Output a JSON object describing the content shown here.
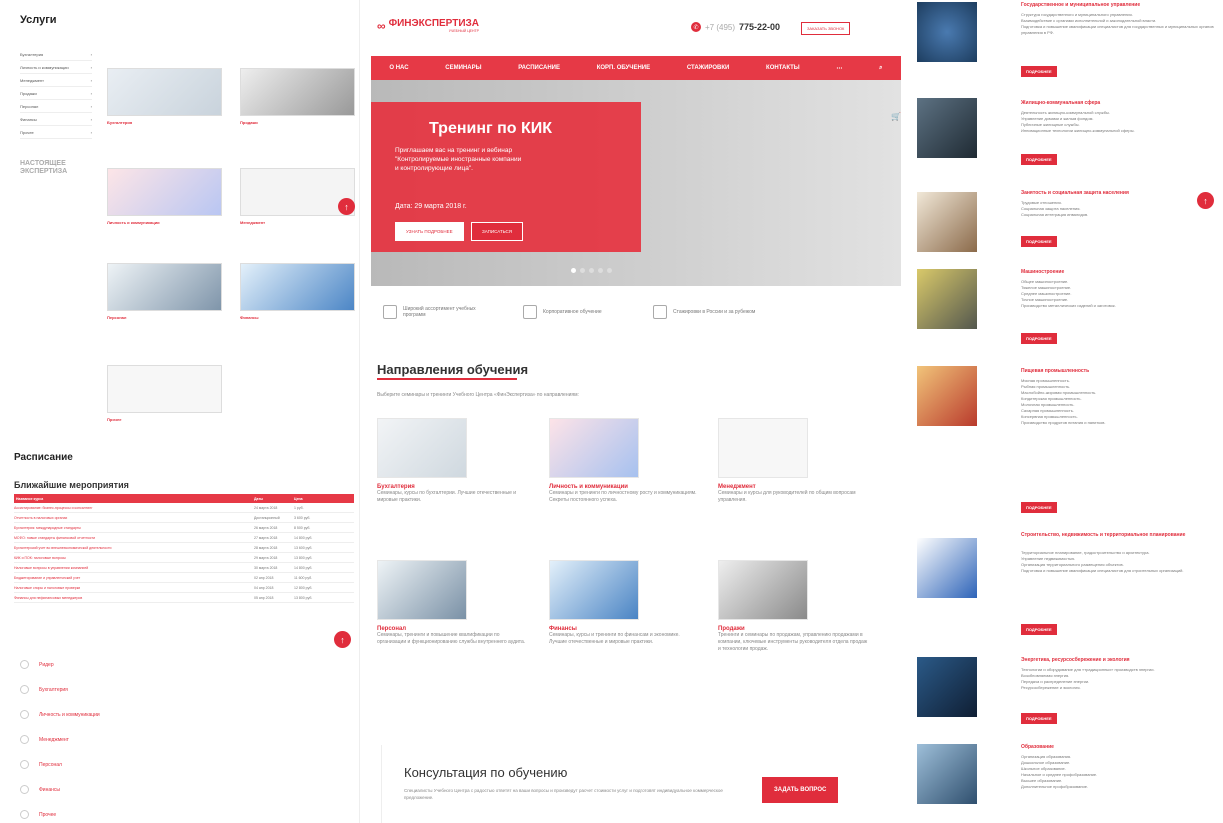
{
  "left": {
    "services_title": "Услуги",
    "menu": [
      "Бухгалтерия",
      "Личность и коммуникации",
      "Менеджмент",
      "Продажи",
      "Персонал",
      "Финансы",
      "Прочее"
    ],
    "logo_text": "НАСТОЯЩЕЕ ЭКСПЕРТИЗА",
    "cards": [
      {
        "title": "Бухгалтерия"
      },
      {
        "title": "Продажи"
      },
      {
        "title": "Личность и коммуникации"
      },
      {
        "title": "Менеджмент"
      },
      {
        "title": "Персонал"
      },
      {
        "title": "Финансы"
      },
      {
        "title": "Прочее"
      }
    ],
    "schedule_title": "Расписание",
    "nearest_events": "Ближайшие мероприятия",
    "table_headers": [
      "Название курса",
      "Даты",
      "Цена"
    ],
    "table_rows": [
      [
        "Ассистирование: бизнес-процессы и консалтинг",
        "24 марта 2018",
        "1 руб."
      ],
      [
        "Отчетность в налоговых органах",
        "Дистанционный",
        "3 600 руб."
      ],
      [
        "Бухгалтерия: международные стандарты",
        "26 марта 2018",
        "8 500 руб."
      ],
      [
        "МСФО: новые стандарты финансовой отчетности",
        "27 марта 2018",
        "14 800 руб."
      ],
      [
        "Бухгалтерский учет во внешнеэкономической деятельности",
        "28 марта 2018",
        "13 600 руб."
      ],
      [
        "КИК и ПОК: налоговые вопросы",
        "29 марта 2018",
        "13 800 руб."
      ],
      [
        "Налоговые вопросы в управлении компанией",
        "30 марта 2018",
        "14 800 руб."
      ],
      [
        "Бюджетирование и управленческий учет",
        "02 апр 2018",
        "11 600 руб."
      ],
      [
        "Налоговые споры и налоговые проверки",
        "04 апр 2018",
        "12 800 руб."
      ],
      [
        "Финансы для нефинансовых менеджеров",
        "05 апр 2018",
        "13 800 руб."
      ]
    ],
    "bottom_nav": [
      "Ридер",
      "Бухгалтерия",
      "Личность и коммуникации",
      "Менеджмент",
      "Персонал",
      "Финансы",
      "Прочее"
    ]
  },
  "center": {
    "brand": "ФИНЭКСПЕРТИЗА",
    "brand_sub": "УЧЕБНЫЙ ЦЕНТР",
    "phone_prefix": "+7 (495)",
    "phone": "775-22-00",
    "callback": "ЗАКАЗАТЬ ЗВОНОК",
    "nav": [
      "О НАС",
      "СЕМИНАРЫ",
      "РАСПИСАНИЕ",
      "КОРП. ОБУЧЕНИЕ",
      "СТАЖИРОВКИ",
      "КОНТАКТЫ"
    ],
    "hero": {
      "title": "Тренинг по КИК",
      "line1": "Приглашаем вас на тренинг и вебинар",
      "line2": "\"Контролируемые иностранные компании",
      "line3": "и контролирующие лица\".",
      "date": "Дата: 29 марта 2018 г.",
      "btn_more": "УЗНАТЬ ПОДРОБНЕЕ",
      "btn_signup": "ЗАПИСАТЬСЯ"
    },
    "features": [
      "Широкий ассортимент учебных программ",
      "Корпоративное обучение",
      "Стажировки в России и за рубежом"
    ],
    "directions_title": "Направления обучения",
    "directions_sub": "Выберите семинары и тренинги Учебного Центра «ФинЭкспертиза» по направлениям:",
    "directions": [
      {
        "title": "Бухгалтерия",
        "desc": "Семинары, курсы по бухгалтерии. Лучшие отечественные и мировые практики."
      },
      {
        "title": "Личность и коммуникации",
        "desc": "Семинары и тренинги по личностному росту и коммуникациям. Секреты постоянного успеха."
      },
      {
        "title": "Менеджмент",
        "desc": "Семинары и курсы для руководителей по общим вопросам управления."
      },
      {
        "title": "Персонал",
        "desc": "Семинары, тренинги и повышение квалификации по организации и функционированию службы внутреннего аудита."
      },
      {
        "title": "Финансы",
        "desc": "Семинары, курсы и тренинги по финансам и экономике. Лучшие отечественные и мировые практики."
      },
      {
        "title": "Продажи",
        "desc": "Тренинги и семинары по продажам, управлению продажами в компании, ключевые инструменты руководителя отдела продаж и технологии продаж."
      }
    ],
    "consult_title": "Консультация по обучению",
    "consult_text": "Специалисты Учебного Центра с радостью ответят на ваши вопросы и произведут расчет стоимости услуг и подготовят индивидуальное коммерческое предложение.",
    "ask_button": "ЗАДАТЬ ВОПРОС"
  },
  "right": {
    "button": "ПОДРОБНЕЕ",
    "sections": [
      {
        "title": "Государственное и муниципальное управление",
        "lines": [
          "Структура государственного и муниципального управления.",
          "Взаимодействие с органами исполнительной и законодательной власти.",
          "Подготовка и повышение квалификации специалистов для государственных и муниципальных органов управления в РФ."
        ]
      },
      {
        "title": "Жилищно-коммунальная сфера",
        "lines": [
          "Деятельность жилищно-коммунальной службы.",
          "Управление домами и жилым фондом.",
          "Публичные жилищные службы.",
          "Инновационные технологии жилищно-коммунальной сферы."
        ]
      },
      {
        "title": "Занятость и социальная защита населения",
        "lines": [
          "Трудовые отношения.",
          "Социальная защита населения.",
          "Социальная интеграция инвалидов."
        ]
      },
      {
        "title": "Машиностроение",
        "lines": [
          "Общее машиностроение.",
          "Тяжелое машиностроение.",
          "Среднее машиностроение.",
          "Точное машиностроение.",
          "Производство металлических изделий и заготовок."
        ]
      },
      {
        "title": "Пищевая промышленность",
        "lines": [
          "Мясная промышленность.",
          "Рыбная промышленность.",
          "Маслобойно-жировая промышленность.",
          "Кондитерская промышленность.",
          "Молочная промышленность.",
          "Сахарная промышленность.",
          "Консервная промышленность.",
          "Производство продуктов питания и напитков."
        ]
      },
      {
        "title": "Строительство, недвижимость и территориальное планирование",
        "lines": [
          "Территориальное планирование, градостроительство и архитектура.",
          "Управление недвижимостью.",
          "Организация территориального размещения объектов.",
          "Подготовка и повышение квалификации специалистов для строительных организаций."
        ]
      },
      {
        "title": "Энергетика, ресурсосбережение и экология",
        "lines": [
          "Технологии и оборудование для «традиционных» производств энергии.",
          "Возобновляемая энергия.",
          "Передача и распределение энергии.",
          "Ресурсосбережение и экология."
        ]
      },
      {
        "title": "Образование",
        "lines": [
          "Организация образования.",
          "Дошкольное образование.",
          "Школьное образование.",
          "Начальное и среднее профобразование.",
          "Высшее образование.",
          "Дополнительное профобразование."
        ]
      }
    ]
  }
}
